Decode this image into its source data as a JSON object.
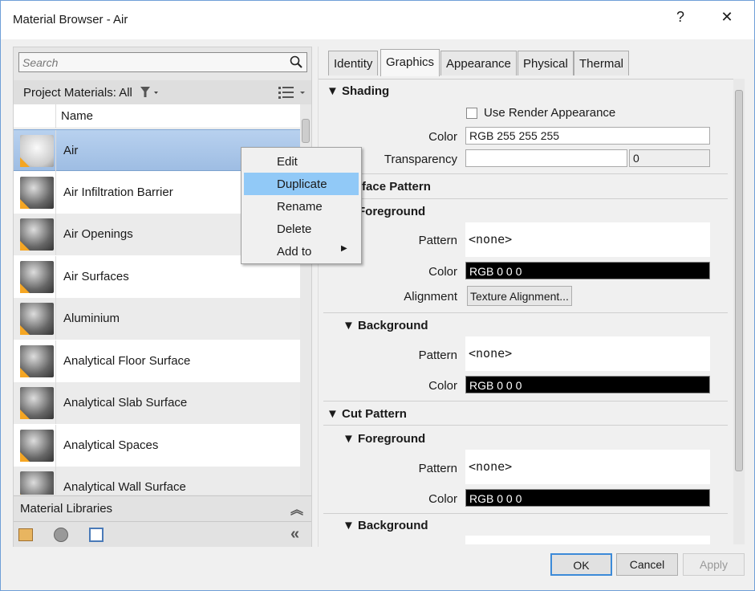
{
  "window": {
    "title": "Material Browser - Air",
    "help": "?",
    "close": "✕"
  },
  "left": {
    "search_placeholder": "Search",
    "filter_label": "Project Materials: All",
    "column_name": "Name",
    "materials": [
      {
        "name": "Air",
        "selected": true
      },
      {
        "name": "Air Infiltration Barrier"
      },
      {
        "name": "Air Openings"
      },
      {
        "name": "Air Surfaces"
      },
      {
        "name": "Aluminium"
      },
      {
        "name": "Analytical Floor Surface"
      },
      {
        "name": "Analytical Slab Surface"
      },
      {
        "name": "Analytical Spaces"
      },
      {
        "name": "Analytical Wall Surface"
      }
    ],
    "libraries_label": "Material Libraries"
  },
  "context_menu": {
    "items": [
      "Edit",
      "Duplicate",
      "Rename",
      "Delete",
      "Add to"
    ],
    "highlighted": "Duplicate"
  },
  "tabs": [
    "Identity",
    "Graphics",
    "Appearance",
    "Physical",
    "Thermal"
  ],
  "active_tab": "Graphics",
  "graphics": {
    "shading": {
      "title": "Shading",
      "use_render_appearance": "Use Render Appearance",
      "color_label": "Color",
      "color": "RGB 255 255 255",
      "transparency_label": "Transparency",
      "transparency": "0"
    },
    "surface_pattern": {
      "title": "Surface Pattern",
      "foreground": "Foreground",
      "pattern_label": "Pattern",
      "pattern": "<none>",
      "color_label": "Color",
      "color": "RGB 0 0 0",
      "alignment_label": "Alignment",
      "alignment_button": "Texture Alignment...",
      "background": "Background",
      "bg_pattern": "<none>",
      "bg_color": "RGB 0 0 0"
    },
    "cut_pattern": {
      "title": "Cut Pattern",
      "foreground": "Foreground",
      "pattern": "<none>",
      "color": "RGB 0 0 0",
      "background": "Background"
    }
  },
  "buttons": {
    "ok": "OK",
    "cancel": "Cancel",
    "apply": "Apply"
  }
}
